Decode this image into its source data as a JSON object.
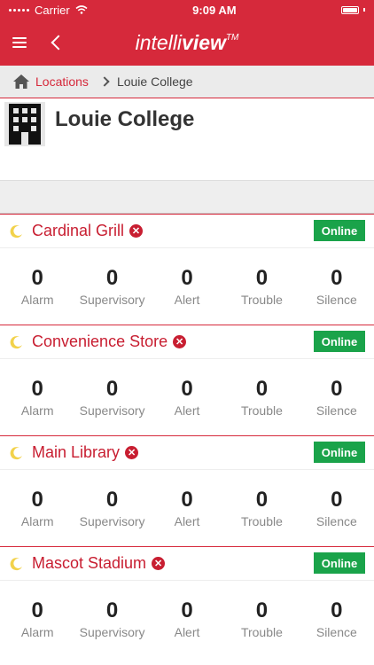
{
  "status_bar": {
    "carrier": "Carrier",
    "time": "9:09 AM"
  },
  "nav": {
    "logo_light": "intelli",
    "logo_bold": "view",
    "logo_mark": "TM"
  },
  "breadcrumb": {
    "link": "Locations",
    "current": "Louie College"
  },
  "page": {
    "title": "Louie College"
  },
  "locations": [
    {
      "name": "Cardinal Grill",
      "status": "Online",
      "counts": [
        {
          "value": "0",
          "label": "Alarm"
        },
        {
          "value": "0",
          "label": "Supervisory"
        },
        {
          "value": "0",
          "label": "Alert"
        },
        {
          "value": "0",
          "label": "Trouble"
        },
        {
          "value": "0",
          "label": "Silence"
        }
      ]
    },
    {
      "name": "Convenience Store",
      "status": "Online",
      "counts": [
        {
          "value": "0",
          "label": "Alarm"
        },
        {
          "value": "0",
          "label": "Supervisory"
        },
        {
          "value": "0",
          "label": "Alert"
        },
        {
          "value": "0",
          "label": "Trouble"
        },
        {
          "value": "0",
          "label": "Silence"
        }
      ]
    },
    {
      "name": "Main Library",
      "status": "Online",
      "counts": [
        {
          "value": "0",
          "label": "Alarm"
        },
        {
          "value": "0",
          "label": "Supervisory"
        },
        {
          "value": "0",
          "label": "Alert"
        },
        {
          "value": "0",
          "label": "Trouble"
        },
        {
          "value": "0",
          "label": "Silence"
        }
      ]
    },
    {
      "name": "Mascot Stadium",
      "status": "Online",
      "counts": [
        {
          "value": "0",
          "label": "Alarm"
        },
        {
          "value": "0",
          "label": "Supervisory"
        },
        {
          "value": "0",
          "label": "Alert"
        },
        {
          "value": "0",
          "label": "Trouble"
        },
        {
          "value": "0",
          "label": "Silence"
        }
      ]
    }
  ],
  "colors": {
    "brand_red": "#d6293b",
    "online_green": "#1aa34a"
  },
  "icons": {
    "home": "home-icon",
    "building": "building-icon",
    "moon": "moon-icon",
    "remove": "remove-icon"
  }
}
